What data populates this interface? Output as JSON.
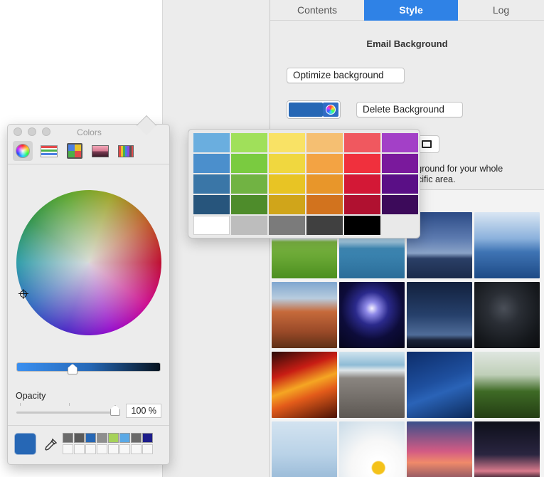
{
  "tabs": [
    {
      "label": "Contents",
      "active": false
    },
    {
      "label": "Style",
      "active": true
    },
    {
      "label": "Log",
      "active": false
    }
  ],
  "style": {
    "section_title": "Email Background",
    "optimize_button": "Optimize background",
    "delete_button": "Delete Background",
    "selected_color": "#2667b5",
    "hint_line1": "kground for your whole",
    "hint_line2": "ecific area."
  },
  "colors_panel": {
    "title": "Colors",
    "opacity_label": "Opacity",
    "opacity_value": "100 %",
    "opacity_level": 1.0,
    "current_color": "#2667b5",
    "toolbar_icons": [
      "color-wheel-icon",
      "color-sliders-icon",
      "color-palettes-icon",
      "image-palettes-icon",
      "pencils-icon"
    ],
    "swatches_row1": [
      "#6b6b6b",
      "#5a5a5a",
      "#2667b5",
      "#8e8e8e",
      "#a6d25a",
      "#5aa9e6",
      "#6a6a6a",
      "#1c1c8a"
    ]
  },
  "palette": {
    "rows": [
      [
        "#6aaedf",
        "#a0e05a",
        "#f9e265",
        "#f5bf72",
        "#f0585f",
        "#a340c7"
      ],
      [
        "#4b8fcc",
        "#7acb40",
        "#f0d73f",
        "#f3a343",
        "#f0303d",
        "#7a199c"
      ],
      [
        "#3a76a7",
        "#71b343",
        "#e8c424",
        "#e8962a",
        "#d31836",
        "#5a0f86"
      ],
      [
        "#27557c",
        "#4e8c2b",
        "#d0a51a",
        "#d2731e",
        "#b01130",
        "#3c0a5a"
      ],
      [
        "#ffffff",
        "#bdbdbd",
        "#7b7b7b",
        "#404040",
        "#000000"
      ]
    ]
  },
  "background_thumbnails": [
    "green-hill",
    "ocean-coast",
    "dusk-horizon",
    "blue-mountains",
    "rock-canyon",
    "fireworks",
    "night-sky-mountain",
    "star-trails",
    "red-phone-box-light-trails",
    "pebble-beach",
    "starry-sky",
    "dandelion-field",
    "misty-bridge",
    "white-daisy",
    "pink-sunset",
    "dark-dusk-hills"
  ]
}
